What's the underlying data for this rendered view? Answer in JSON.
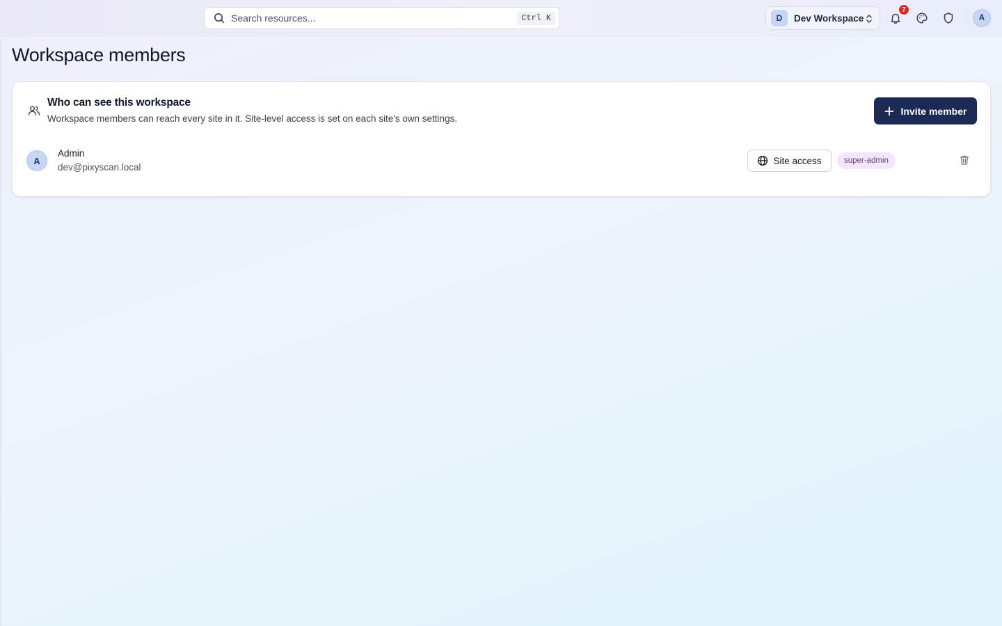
{
  "search": {
    "placeholder": "Search resources...",
    "shortcut": "Ctrl K",
    "icon": "search-icon"
  },
  "workspace_switcher": {
    "initial": "D",
    "name": "Dev Workspace",
    "icon": "chevron-up-down-icon"
  },
  "notifications": {
    "count": "7",
    "icon": "bell-icon"
  },
  "toolbar_icons": [
    "palette-icon",
    "shield-icon"
  ],
  "user": {
    "initial": "A"
  },
  "page": {
    "title": "Workspace members"
  },
  "card": {
    "icon": "users-icon",
    "title": "Who can see this workspace",
    "subtitle": "Workspace members can reach every site in it. Site-level access is set on each site's own settings.",
    "invite_label": "Invite member"
  },
  "members": [
    {
      "initial": "A",
      "name": "Admin",
      "email": "dev@pixyscan.local",
      "site_access_label": "Site access",
      "role": "super-admin"
    }
  ],
  "colors": {
    "primary_button": "#1b2a55",
    "notification_badge": "#dc2626",
    "avatar_bg": "#c7d6f5",
    "role_badge_bg": "#f3e8fb",
    "role_badge_text": "#6b3a8c"
  }
}
